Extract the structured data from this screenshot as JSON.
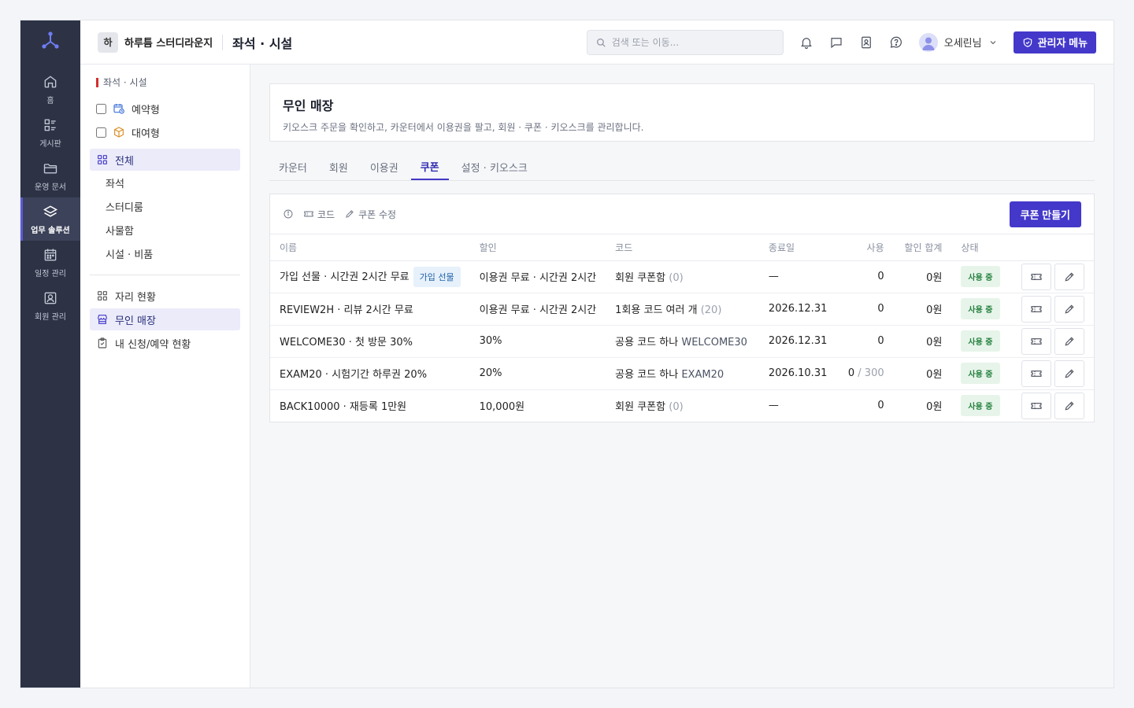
{
  "rail": {
    "items": [
      {
        "label": "홈",
        "icon": "home-icon"
      },
      {
        "label": "게시판",
        "icon": "board-icon"
      },
      {
        "label": "운영 문서",
        "icon": "folder-icon"
      },
      {
        "label": "업무 솔루션",
        "icon": "layers-icon",
        "active": true
      },
      {
        "label": "일정 관리",
        "icon": "calendar-icon"
      },
      {
        "label": "회원 관리",
        "icon": "member-icon"
      }
    ]
  },
  "topbar": {
    "org_badge": "하",
    "org_name": "하루틈 스터디라운지",
    "page": "좌석 · 시설",
    "search_placeholder": "검색 또는 이동...",
    "user_name": "오세린님",
    "admin_label": "관리자 메뉴"
  },
  "subnav": {
    "section": "좌석 · 시설",
    "check_items": [
      "예약형",
      "대여형"
    ],
    "all_label": "전체",
    "sub_items": [
      "좌석",
      "스터디룸",
      "사물함",
      "시설 · 비품"
    ],
    "bottom_items": [
      "자리 현황",
      "무인 매장",
      "내 신청/예약 현황"
    ]
  },
  "page": {
    "title": "무인 매장",
    "description": "키오스크 주문을 확인하고, 카운터에서 이용권을 팔고, 회원 · 쿠폰 · 키오스크를 관리합니다."
  },
  "tabs": [
    "카운터",
    "회원",
    "이용권",
    "쿠폰",
    "설정 · 키오스크"
  ],
  "toolbar": {
    "code_label": "코드",
    "edit_label": "쿠폰 수정",
    "create_label": "쿠폰 만들기"
  },
  "table": {
    "headers": [
      "이름",
      "할인",
      "코드",
      "종료일",
      "사용",
      "할인 합계",
      "상태"
    ],
    "rows": [
      {
        "name": "가입 선물 · 시간권 2시간 무료",
        "tag": "가입 선물",
        "discount": "이용권 무료 · 시간권 2시간",
        "code_text": "회원 쿠폰함",
        "code_extra": "(0)",
        "end": "—",
        "used": "0",
        "used_limit": "",
        "total": "0원",
        "status": "사용 중"
      },
      {
        "name": "REVIEW2H · 리뷰 2시간 무료",
        "tag": "",
        "discount": "이용권 무료 · 시간권 2시간",
        "code_text": "1회용 코드 여러 개",
        "code_extra": "(20)",
        "end": "2026.12.31",
        "used": "0",
        "used_limit": "",
        "total": "0원",
        "status": "사용 중"
      },
      {
        "name": "WELCOME30 · 첫 방문 30%",
        "tag": "",
        "discount": "30%",
        "code_text": "공용 코드 하나",
        "code_extra": "WELCOME30",
        "end": "2026.12.31",
        "used": "0",
        "used_limit": "",
        "total": "0원",
        "status": "사용 중"
      },
      {
        "name": "EXAM20 · 시험기간 하루권 20%",
        "tag": "",
        "discount": "20%",
        "code_text": "공용 코드 하나",
        "code_extra": "EXAM20",
        "end": "2026.10.31",
        "used": "0",
        "used_limit": " / 300",
        "total": "0원",
        "status": "사용 중"
      },
      {
        "name": "BACK10000 · 재등록 1만원",
        "tag": "",
        "discount": "10,000원",
        "code_text": "회원 쿠폰함",
        "code_extra": "(0)",
        "end": "—",
        "used": "0",
        "used_limit": "",
        "total": "0원",
        "status": "사용 중"
      }
    ]
  },
  "colors": {
    "accent": "#4338ca",
    "rail": "#2d3345",
    "status_bg": "#e7f4ea",
    "status_fg": "#23803d"
  }
}
